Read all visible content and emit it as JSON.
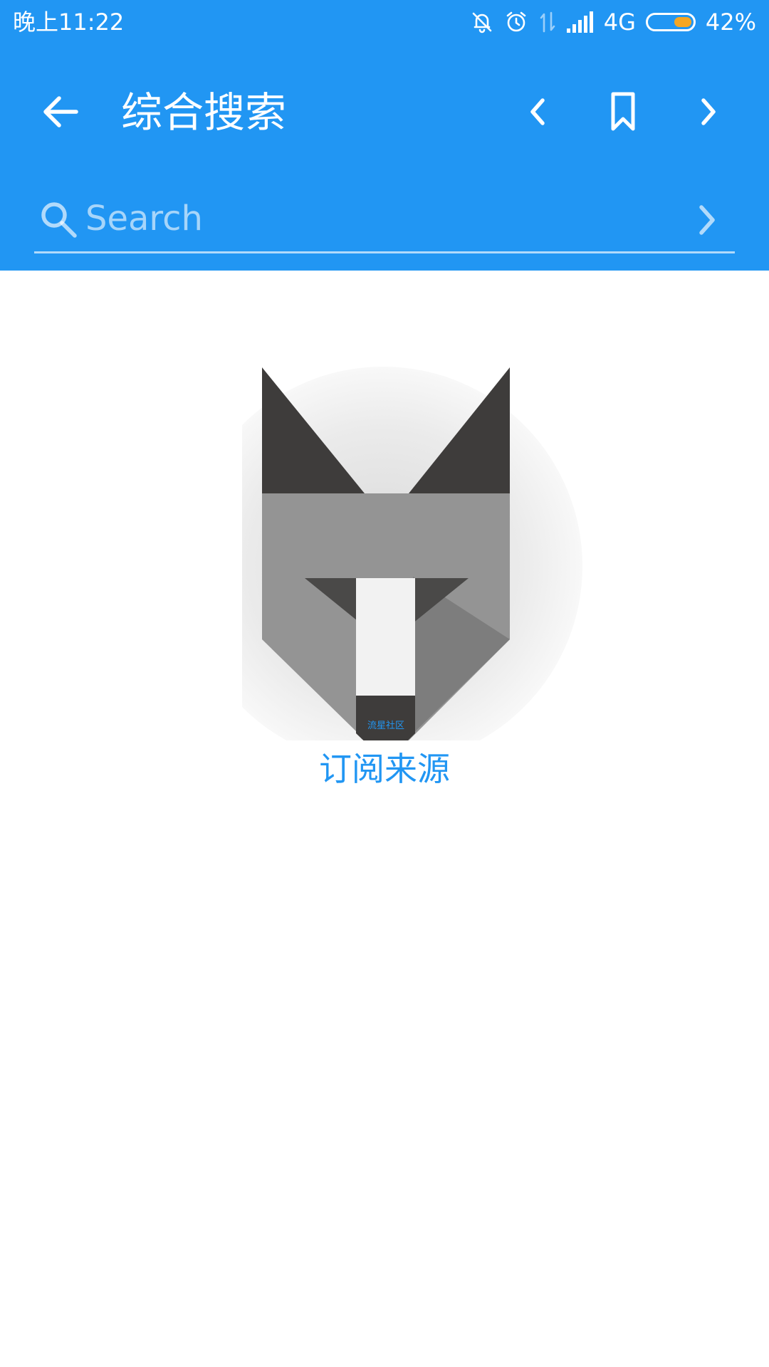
{
  "status_bar": {
    "time": "晚上11:22",
    "network": "4G",
    "battery": "42%",
    "battery_level": 0.42,
    "icons": [
      "bell-off-icon",
      "alarm-icon",
      "data-arrows-icon",
      "signal-icon",
      "battery-icon"
    ]
  },
  "toolbar": {
    "title": "综合搜索",
    "icons": [
      "arrow-back-icon",
      "chevron-left-icon",
      "bookmark-icon",
      "chevron-right-icon"
    ]
  },
  "search": {
    "placeholder": "Search",
    "value": "",
    "icons": [
      "search-icon",
      "chevron-right-icon"
    ]
  },
  "main": {
    "logo_caption": "流星社区",
    "link_label": "订阅来源"
  },
  "colors": {
    "primary": "#2196F3",
    "battery_fill": "#F5A623",
    "logo_dark": "#3E3C3B",
    "logo_mid": "#949494",
    "logo_light": "#F2F2F2"
  }
}
